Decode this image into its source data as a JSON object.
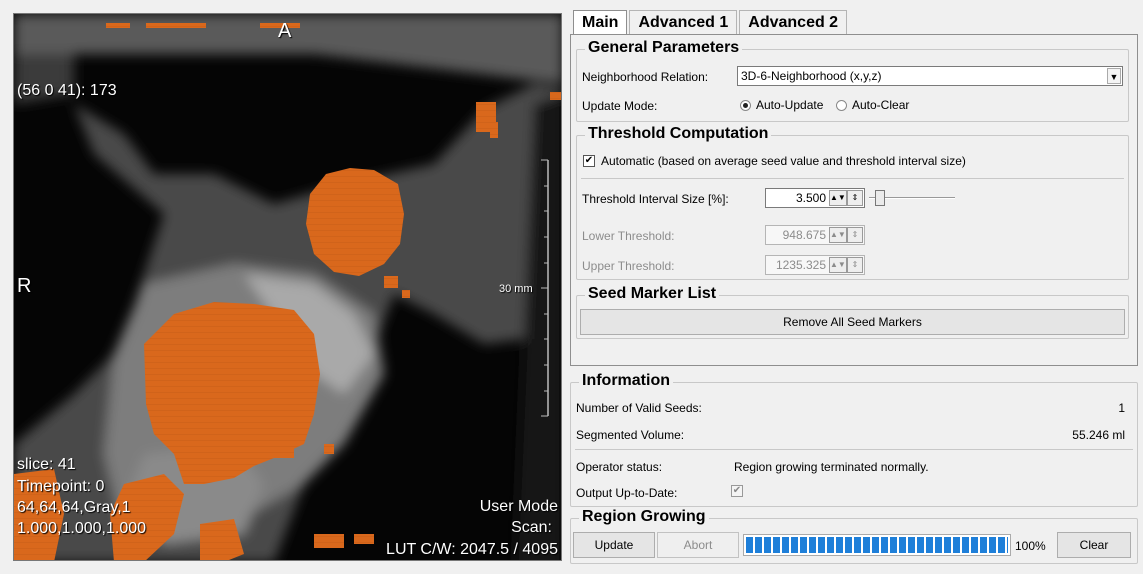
{
  "viewer": {
    "orient_top": "A",
    "orient_left": "R",
    "pixel_readout": "(56 0 41): 173",
    "scale_label": "30 mm",
    "slice": "slice:  41",
    "timepoint": "Timepoint: 0",
    "dims": "64,64,64,Gray,1",
    "spacing": "1.000,1.000,1.000",
    "user_mode": "User Mode",
    "scan": "Scan:",
    "lut": "LUT C/W: 2047.5 / 4095",
    "overlay_color": "#d9681c"
  },
  "tabs": [
    "Main",
    "Advanced 1",
    "Advanced 2"
  ],
  "general": {
    "title": "General Parameters",
    "neighborhood_label": "Neighborhood Relation:",
    "neighborhood_value": "3D-6-Neighborhood (x,y,z)",
    "update_mode_label": "Update Mode:",
    "auto_update": "Auto-Update",
    "auto_clear": "Auto-Clear",
    "selected_mode": "Auto-Update"
  },
  "threshold": {
    "title": "Threshold Computation",
    "automatic_label": "Automatic (based on average seed value and threshold interval size)",
    "automatic_checked": true,
    "interval_label": "Threshold Interval Size [%]:",
    "interval_value": "3.500",
    "lower_label": "Lower Threshold:",
    "lower_value": "948.675",
    "upper_label": "Upper Threshold:",
    "upper_value": "1235.325"
  },
  "seeds": {
    "title": "Seed Marker List",
    "remove_all": "Remove All Seed Markers"
  },
  "info": {
    "title": "Information",
    "valid_seeds_label": "Number of Valid Seeds:",
    "valid_seeds_value": "1",
    "volume_label": "Segmented Volume:",
    "volume_value": "55.246 ml",
    "operator_label": "Operator status:",
    "operator_value": "Region growing terminated normally.",
    "uptodate_label": "Output Up-to-Date:",
    "uptodate_checked": true
  },
  "region": {
    "title": "Region Growing",
    "update": "Update",
    "abort": "Abort",
    "progress_percent": 100,
    "progress_label": "100%",
    "clear": "Clear"
  }
}
